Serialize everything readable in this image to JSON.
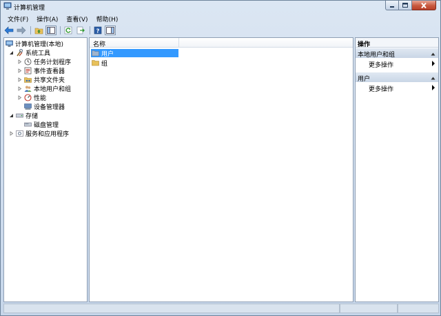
{
  "window": {
    "title": "计算机管理"
  },
  "menu": [
    {
      "label": "文件(F)"
    },
    {
      "label": "操作(A)"
    },
    {
      "label": "查看(V)"
    },
    {
      "label": "帮助(H)"
    }
  ],
  "toolbar": {
    "icons": [
      "back-arrow-icon",
      "forward-arrow-icon",
      "up-folder-icon",
      "show-hide-tree-icon",
      "refresh-icon",
      "export-list-icon",
      "help-icon",
      "properties-icon"
    ]
  },
  "tree": {
    "root": "计算机管理(本地)",
    "system_tools": "系统工具",
    "task_scheduler": "任务计划程序",
    "event_viewer": "事件查看器",
    "shared_folders": "共享文件夹",
    "local_users": "本地用户和组",
    "performance": "性能",
    "device_manager": "设备管理器",
    "storage": "存储",
    "disk_management": "磁盘管理",
    "services_apps": "服务和应用程序"
  },
  "list": {
    "column_name": "名称",
    "items": [
      {
        "name": "用户",
        "selected": true
      },
      {
        "name": "组",
        "selected": false
      }
    ]
  },
  "actions": {
    "title": "操作",
    "section1": "本地用户和组",
    "section1_more": "更多操作",
    "section2": "用户",
    "section2_more": "更多操作"
  },
  "colors": {
    "selection": "#3399ff",
    "folder": "#e8c15a"
  }
}
